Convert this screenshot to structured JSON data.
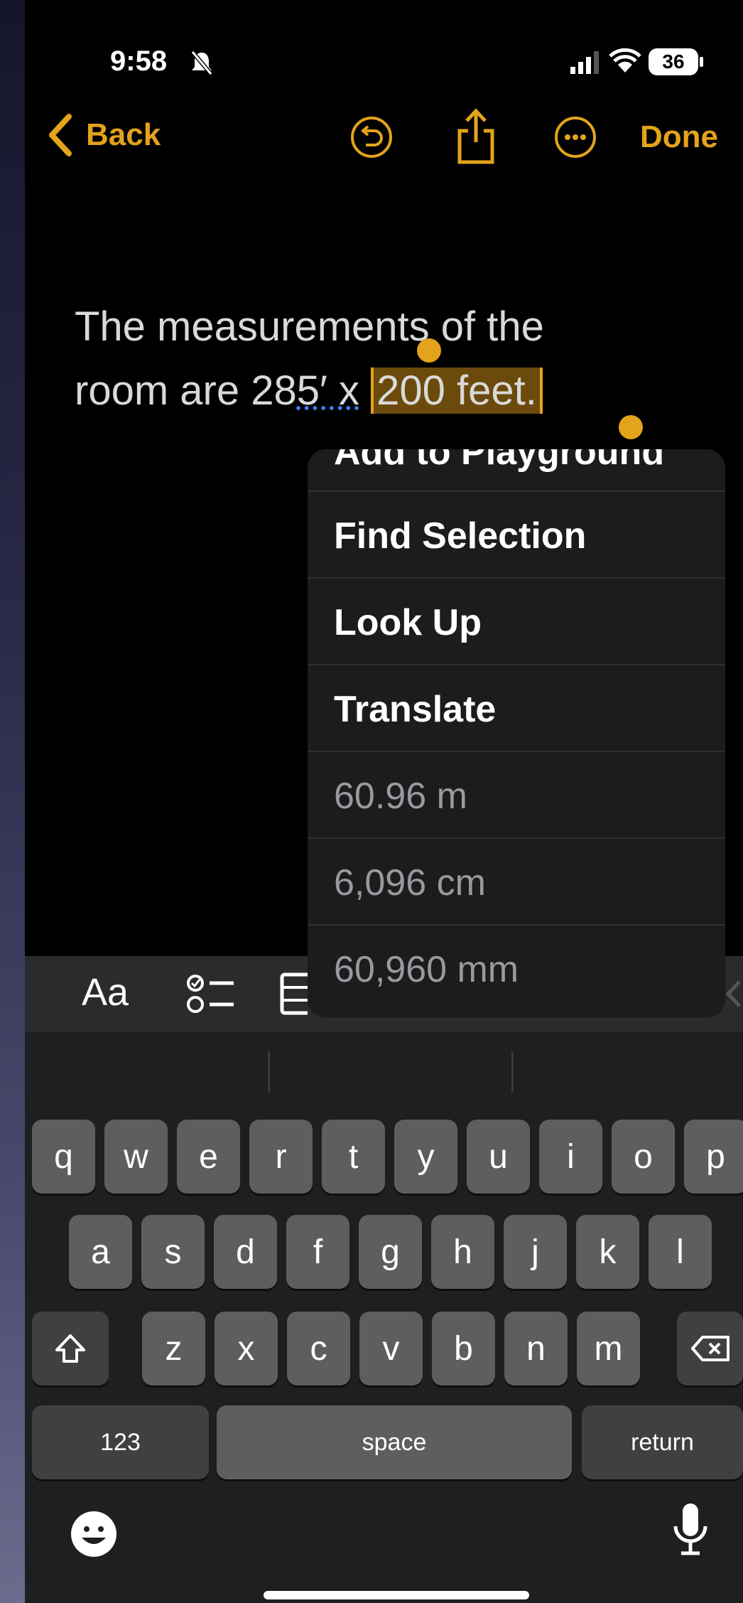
{
  "status": {
    "time": "9:58",
    "battery": "36"
  },
  "nav": {
    "back_label": "Back",
    "done_label": "Done"
  },
  "note": {
    "line1": "The measurements of the",
    "line2_prefix": "room are 28",
    "line2_underlined": "5′ x",
    "line2_selected": "200 feet."
  },
  "menu": {
    "items": [
      "Add to Playground",
      "Find Selection",
      "Look Up",
      "Translate",
      "60.96 m",
      "6,096 cm",
      "60,960 mm"
    ]
  },
  "toolbar": {
    "format_label": "Aa"
  },
  "keyboard": {
    "row1": [
      "q",
      "w",
      "e",
      "r",
      "t",
      "y",
      "u",
      "i",
      "o",
      "p"
    ],
    "row2": [
      "a",
      "s",
      "d",
      "f",
      "g",
      "h",
      "j",
      "k",
      "l"
    ],
    "row3": [
      "z",
      "x",
      "c",
      "v",
      "b",
      "n",
      "m"
    ],
    "numbers_label": "123",
    "space_label": "space",
    "return_label": "return"
  },
  "colors": {
    "accent": "#e3a31a",
    "selection": "#6b4a0c",
    "menu_bg": "#1c1c1e"
  }
}
